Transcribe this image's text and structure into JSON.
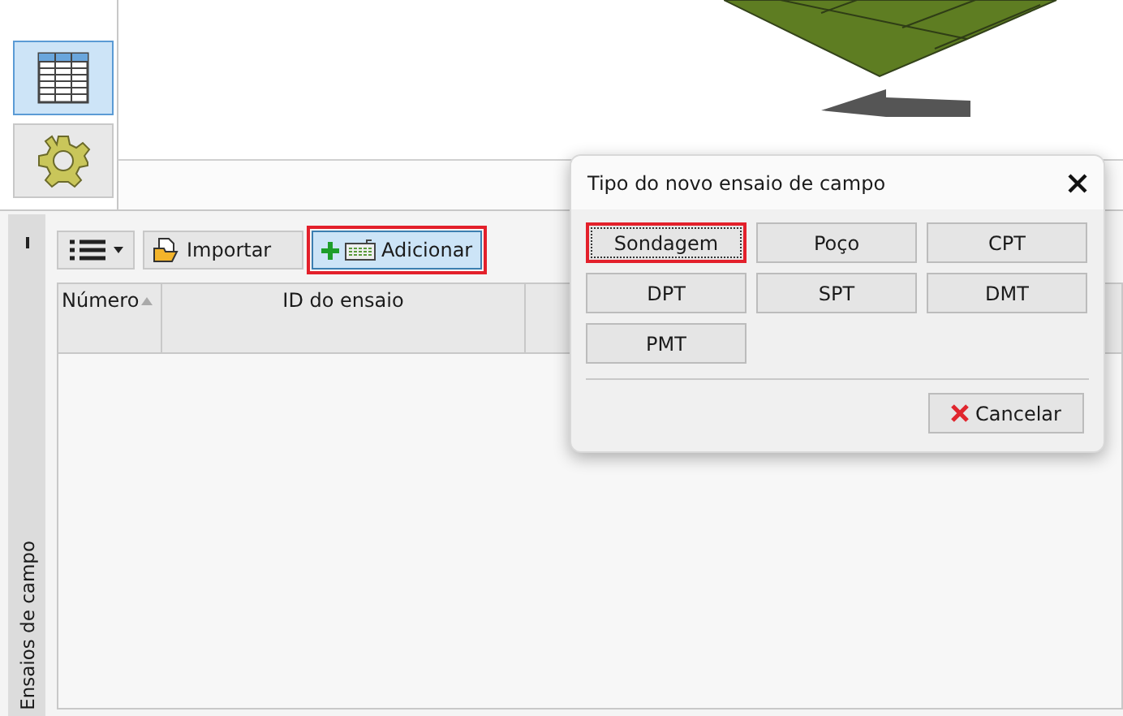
{
  "sidebar": {
    "items": [
      {
        "kind": "table",
        "selected": true
      },
      {
        "kind": "settings",
        "selected": false
      }
    ]
  },
  "side_tab": {
    "label": "Ensaios de campo"
  },
  "toolbar": {
    "buttons": [
      {
        "kind": "menu",
        "highlighted": false
      },
      {
        "kind": "import",
        "label": "Importar",
        "highlighted": false
      },
      {
        "kind": "add",
        "label": "Adicionar",
        "highlighted": true
      }
    ]
  },
  "table": {
    "columns": [
      {
        "label": "Número",
        "sorted": true
      },
      {
        "label": "ID do ensaio",
        "sorted": false
      }
    ]
  },
  "dialog": {
    "title": "Tipo do novo ensaio de campo",
    "options": [
      {
        "label": "Sondagem",
        "focused": true,
        "highlighted": true
      },
      {
        "label": "Poço",
        "focused": false,
        "highlighted": false
      },
      {
        "label": "CPT",
        "focused": false,
        "highlighted": false
      },
      {
        "label": "DPT",
        "focused": false,
        "highlighted": false
      },
      {
        "label": "SPT",
        "focused": false,
        "highlighted": false
      },
      {
        "label": "DMT",
        "focused": false,
        "highlighted": false
      },
      {
        "label": "PMT",
        "focused": false,
        "highlighted": false
      }
    ],
    "cancel_button": {
      "label": "Cancelar"
    }
  }
}
